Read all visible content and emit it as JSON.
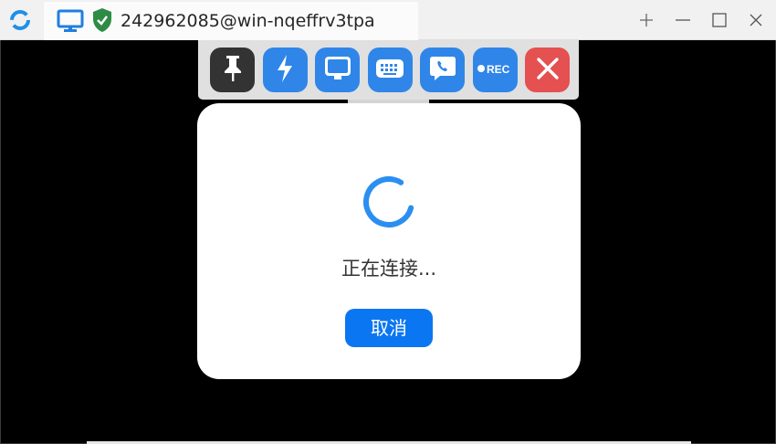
{
  "tab": {
    "title": "242962085@win-nqeffrv3tpa"
  },
  "toolbar": {
    "buttons": [
      {
        "icon": "pin-icon",
        "color": "#333333"
      },
      {
        "icon": "lightning-icon",
        "color": "#2f86e8"
      },
      {
        "icon": "monitor-icon",
        "color": "#2f86e8"
      },
      {
        "icon": "keyboard-icon",
        "color": "#2f86e8"
      },
      {
        "icon": "chat-phone-icon",
        "color": "#2f86e8"
      },
      {
        "icon": "record-icon",
        "label": "REC",
        "color": "#2f86e8"
      },
      {
        "icon": "close-icon",
        "color": "#e55050"
      }
    ]
  },
  "dialog": {
    "status_text": "正在连接...",
    "cancel_label": "取消",
    "accent_color": "#0b76f2"
  }
}
